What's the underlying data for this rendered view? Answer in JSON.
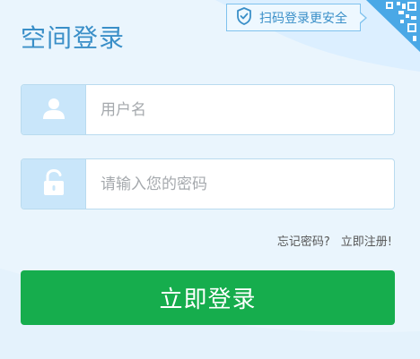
{
  "title": "空间登录",
  "qr_tip": {
    "text": "扫码登录更安全",
    "icon": "shield-check-icon"
  },
  "qr_corner_icon": "qr-code-icon",
  "username": {
    "icon": "user-icon",
    "placeholder": "用户名",
    "value": ""
  },
  "password": {
    "icon": "unlock-icon",
    "placeholder": "请输入您的密码",
    "value": ""
  },
  "links": {
    "forgot": "忘记密码?",
    "register": "立即注册!"
  },
  "login_button": "立即登录",
  "colors": {
    "background": "#eaf5fd",
    "title": "#3a8fc8",
    "icon_box": "#c9e6fa",
    "button": "#16ad4d",
    "border": "#b9dbef"
  }
}
